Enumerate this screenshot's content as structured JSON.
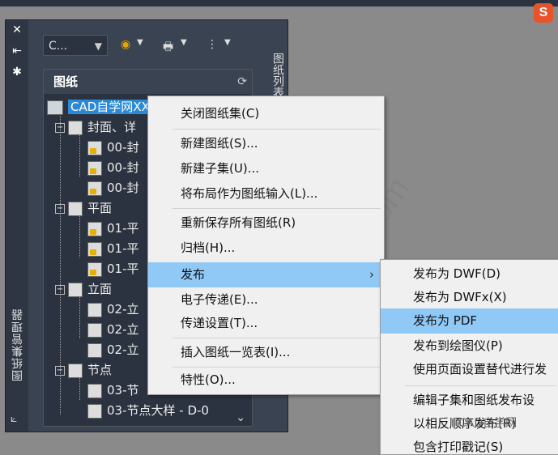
{
  "palette": {
    "rail_title": "图纸集管理器",
    "right_tab": "图纸列表",
    "combo_value": "C...",
    "panel_title": "图纸"
  },
  "tree": {
    "root": "CAD自学网XX项目",
    "group1": "封面、详",
    "g1_items": [
      "00-封",
      "00-封",
      "00-封"
    ],
    "group2": "平面",
    "g2_items": [
      "01-平",
      "01-平",
      "01-平"
    ],
    "group3": "立面",
    "g3_items": [
      "02-立",
      "02-立",
      "02-立"
    ],
    "group4": "节点",
    "g4_items": [
      "03-节",
      "03-节点大样 - D-0"
    ]
  },
  "menu": {
    "items": [
      "关闭图纸集(C)",
      "新建图纸(S)...",
      "新建子集(U)...",
      "将布局作为图纸输入(L)...",
      "重新保存所有图纸(R)",
      "归档(H)...",
      "发布",
      "电子传递(E)...",
      "传递设置(T)...",
      "插入图纸一览表(I)...",
      "特性(O)..."
    ],
    "submenu_arrow": "›"
  },
  "submenu": {
    "items": [
      "发布为 DWF(D)",
      "发布为 DWFx(X)",
      "发布为 PDF",
      "发布到绘图仪(P)",
      "使用页面设置替代进行发",
      "编辑子集和图纸发布设",
      "以相反顺序发布(R)",
      "包含打印戳记(S)"
    ]
  },
  "watermark": {
    "line1": "CAD自学网",
    "line2": "www.cadzxw.com",
    "badge": "CAD自学网"
  },
  "colors": {
    "selection": "#2a8ad8",
    "menu_highlight": "#90c8f6",
    "logo": "#e8532a"
  }
}
